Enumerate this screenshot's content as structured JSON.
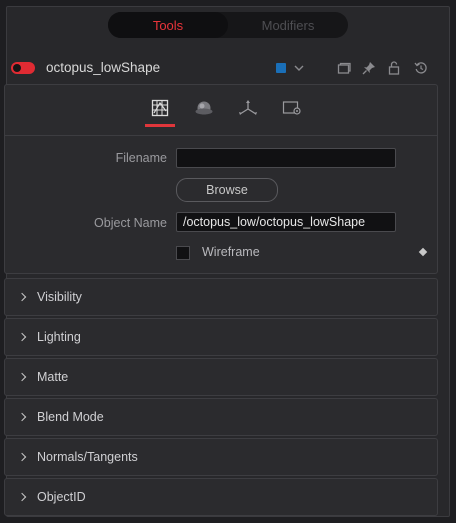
{
  "tabs": [
    {
      "label": "Tools",
      "active": true
    },
    {
      "label": "Modifiers",
      "active": false
    }
  ],
  "header": {
    "tool_name": "octopus_lowShape",
    "swatch_color": "#1a6fb8",
    "toggle_color": "#e02b33",
    "icons": [
      "chevron-down-icon",
      "window-icon",
      "pin-icon",
      "lock-icon",
      "reset-icon"
    ]
  },
  "icon_tabs": [
    {
      "name": "controls-tab-icon",
      "active": true
    },
    {
      "name": "materials-tab-icon",
      "active": false
    },
    {
      "name": "transform-tab-icon",
      "active": false
    },
    {
      "name": "settings-tab-icon",
      "active": false
    }
  ],
  "fields": {
    "filename_label": "Filename",
    "filename_value": "",
    "browse_label": "Browse",
    "object_name_label": "Object Name",
    "object_name_value": "/octopus_low/octopus_lowShape",
    "wireframe_label": "Wireframe",
    "wireframe_checked": false
  },
  "sections": [
    {
      "label": "Visibility"
    },
    {
      "label": "Lighting"
    },
    {
      "label": "Matte"
    },
    {
      "label": "Blend Mode"
    },
    {
      "label": "Normals/Tangents"
    },
    {
      "label": "ObjectID"
    }
  ],
  "accent_color": "#e0363b"
}
